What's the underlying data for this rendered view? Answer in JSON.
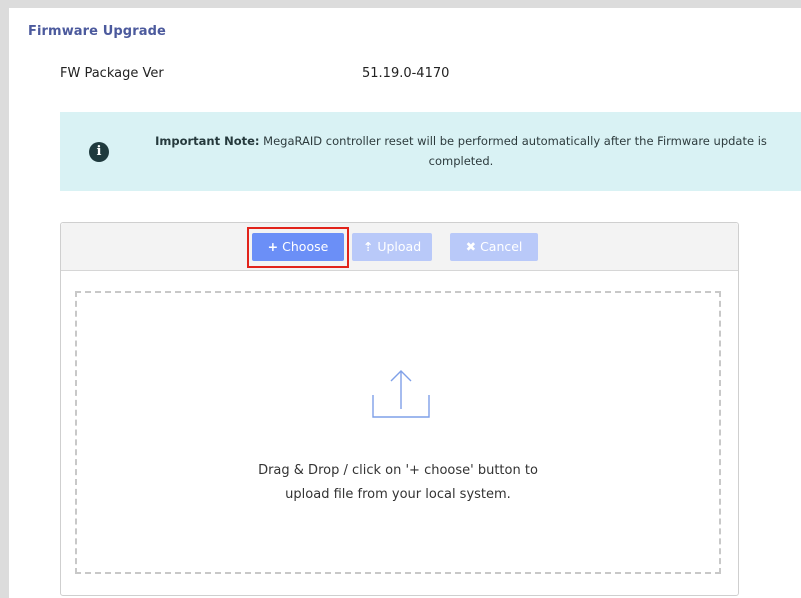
{
  "section": {
    "title": "Firmware Upgrade"
  },
  "info": {
    "label": "FW Package Ver",
    "value": "51.19.0-4170"
  },
  "note": {
    "icon": "info-icon",
    "bold": "Important Note:",
    "text": " MegaRAID controller reset will be performed automatically after the Firmware update is completed."
  },
  "toolbar": {
    "choose_icon": "+",
    "choose_label": "Choose",
    "upload_icon": "⇡",
    "upload_label": "Upload",
    "cancel_icon": "✖",
    "cancel_label": "Cancel"
  },
  "dropzone": {
    "icon": "upload-icon",
    "line1": "Drag & Drop / click on '+ choose' button to",
    "line2": "upload file from your local system."
  },
  "colors": {
    "title": "#4c5a9d",
    "note_bg": "#d9f2f4",
    "primary_button": "#6b8ff7",
    "disabled_button": "#b9c9f9",
    "highlight": "#e2231a"
  }
}
